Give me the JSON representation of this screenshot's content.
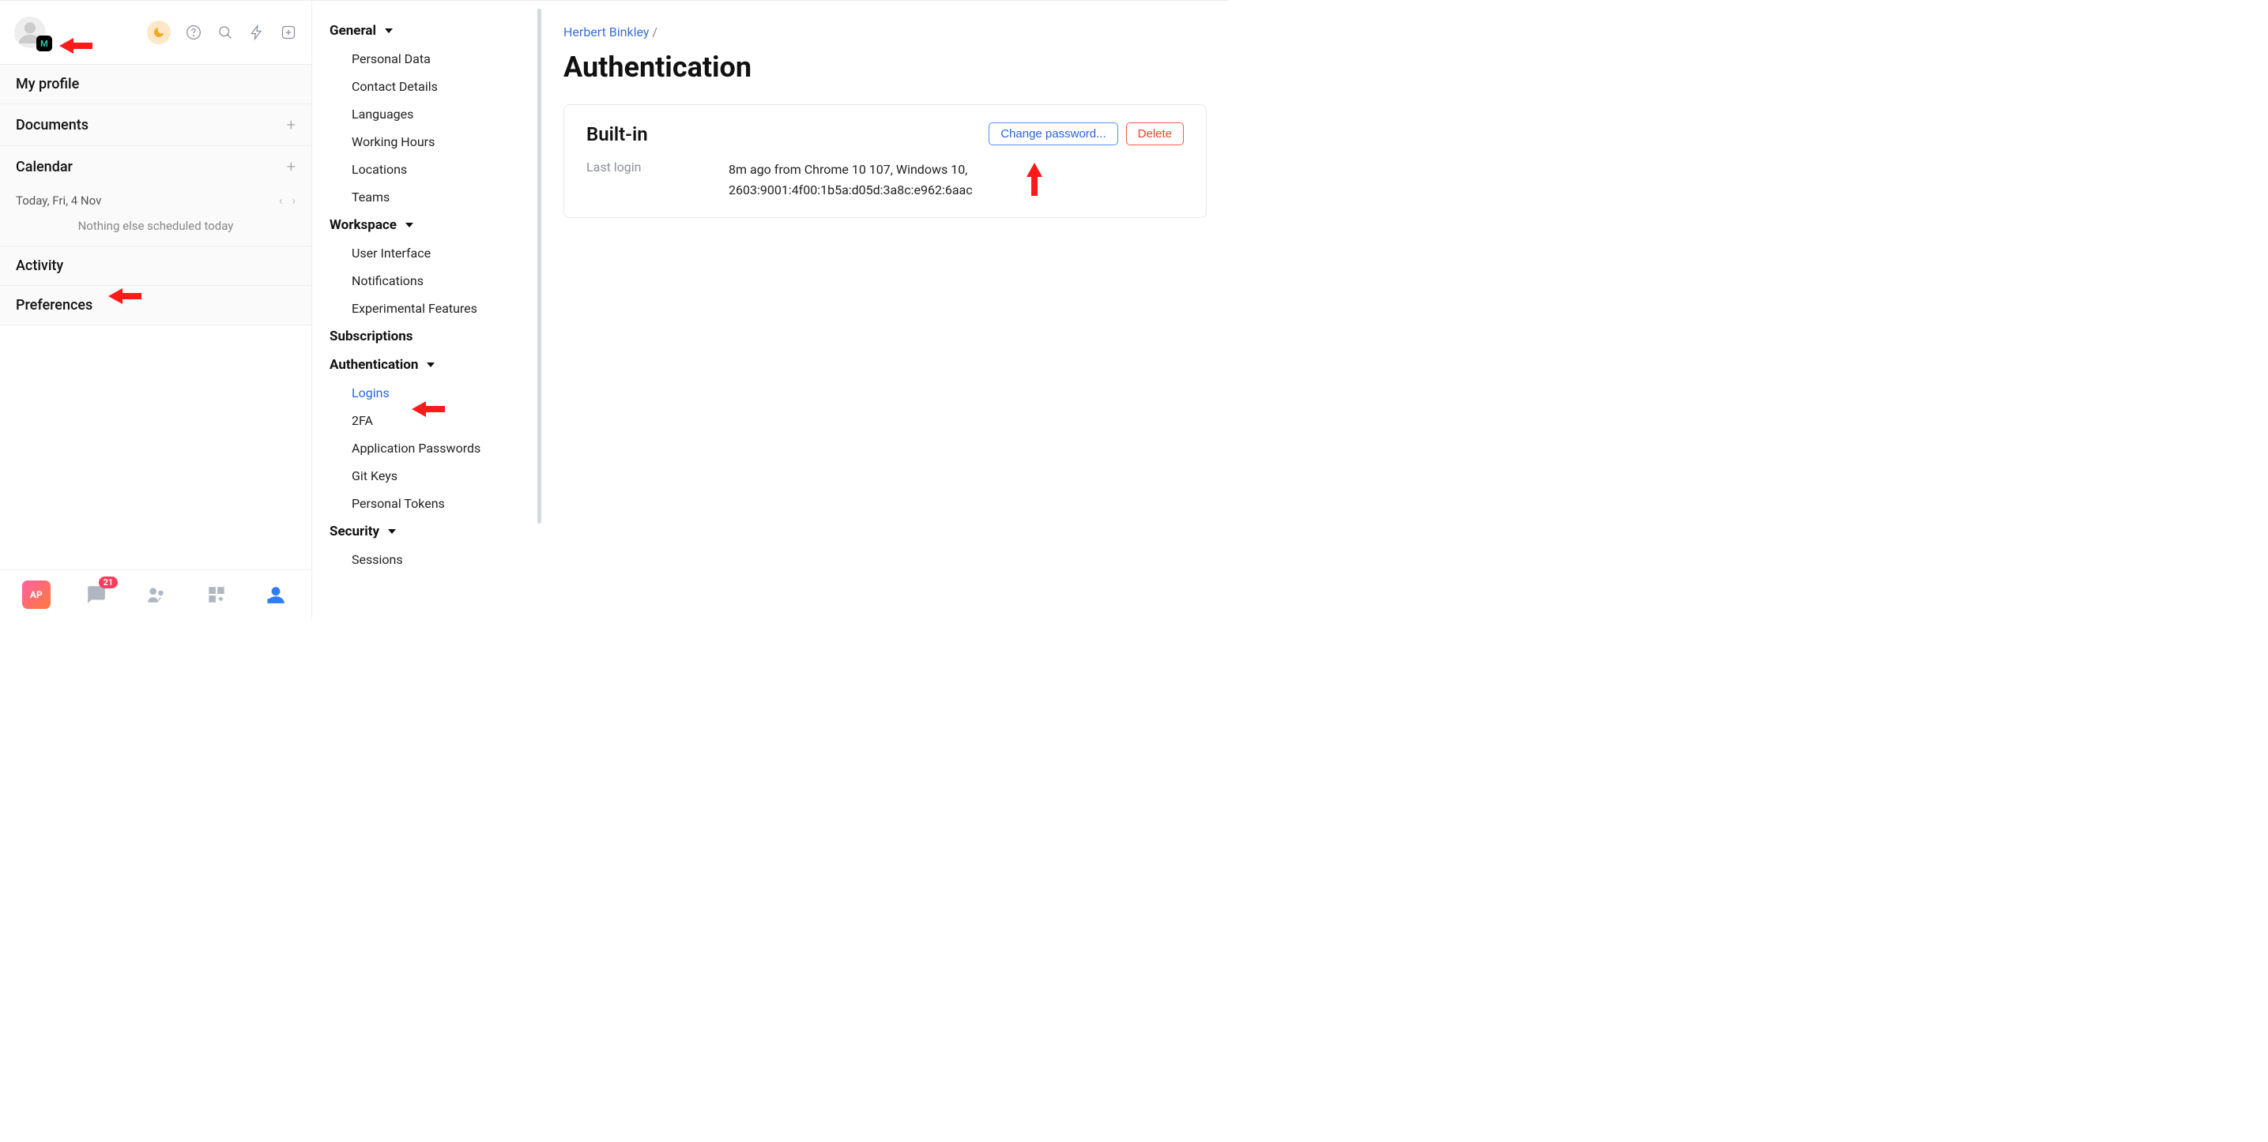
{
  "sidebar": {
    "badge_letter": "M",
    "my_profile": "My profile",
    "documents": "Documents",
    "calendar": "Calendar",
    "calendar_date": "Today, Fri, 4 Nov",
    "calendar_empty": "Nothing else scheduled today",
    "activity": "Activity",
    "preferences": "Preferences",
    "bottom": {
      "ap": "AP",
      "badge_count": "21"
    }
  },
  "nav": {
    "general": {
      "title": "General",
      "items": [
        "Personal Data",
        "Contact Details",
        "Languages",
        "Working Hours",
        "Locations",
        "Teams"
      ]
    },
    "workspace": {
      "title": "Workspace",
      "items": [
        "User Interface",
        "Notifications",
        "Experimental Features"
      ]
    },
    "subscriptions": {
      "title": "Subscriptions"
    },
    "authentication": {
      "title": "Authentication",
      "items": [
        "Logins",
        "2FA",
        "Application Passwords",
        "Git Keys",
        "Personal Tokens"
      ],
      "active": "Logins"
    },
    "security": {
      "title": "Security",
      "items": [
        "Sessions"
      ]
    }
  },
  "main": {
    "breadcrumb_user": "Herbert Binkley",
    "breadcrumb_sep": "/",
    "title": "Authentication",
    "card": {
      "title": "Built-in",
      "change_pw": "Change password...",
      "delete": "Delete",
      "last_login_label": "Last login",
      "last_login_value": "8m ago from Chrome 10 107, Windows 10, 2603:9001:4f00:1b5a:d05d:3a8c:e962:6aac"
    }
  }
}
